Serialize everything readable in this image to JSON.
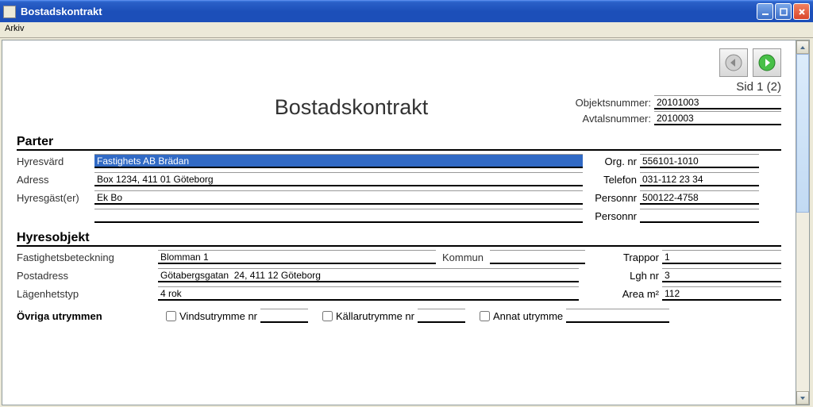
{
  "window": {
    "title": "Bostadskontrakt"
  },
  "menu": {
    "arkiv": "Arkiv"
  },
  "page": {
    "indicator": "Sid 1 (2)",
    "title": "Bostadskontrakt",
    "objektsnummer_label": "Objektsnummer:",
    "objektsnummer": "20101003",
    "avtalsnummer_label": "Avtalsnummer:",
    "avtalsnummer": "2010003"
  },
  "parter": {
    "title": "Parter",
    "hyresvard_label": "Hyresvärd",
    "hyresvard": "Fastighets AB Brädan",
    "orgnr_label": "Org. nr",
    "orgnr": "556101-1010",
    "adress_label": "Adress",
    "adress": "Box 1234, 411 01 Göteborg",
    "telefon_label": "Telefon",
    "telefon": "031-112 23 34",
    "hyresgaster_label": "Hyresgäst(er)",
    "hyresgast1": "Ek Bo",
    "personnr1_label": "Personnr",
    "personnr1": "500122-4758",
    "hyresgast2": "",
    "personnr2_label": "Personnr",
    "personnr2": ""
  },
  "hyresobjekt": {
    "title": "Hyresobjekt",
    "fastighet_label": "Fastighetsbeteckning",
    "fastighet": "Blomman 1",
    "kommun_label": "Kommun",
    "kommun": "",
    "trappor_label": "Trappor",
    "trappor": "1",
    "postadress_label": "Postadress",
    "postadress": "Götabergsgatan  24, 411 12 Göteborg",
    "lghnr_label": "Lgh nr",
    "lghnr": "3",
    "lagenhetstyp_label": "Lägenhetstyp",
    "lagenhetstyp": "4 rok",
    "area_label": "Area m²",
    "area": "112"
  },
  "ovriga": {
    "title": "Övriga utrymmen",
    "vind_label": "Vindsutrymme nr",
    "vind_nr": "",
    "kallar_label": "Källarutrymme nr",
    "kallar_nr": "",
    "annat_label": "Annat utrymme",
    "annat_val": ""
  }
}
